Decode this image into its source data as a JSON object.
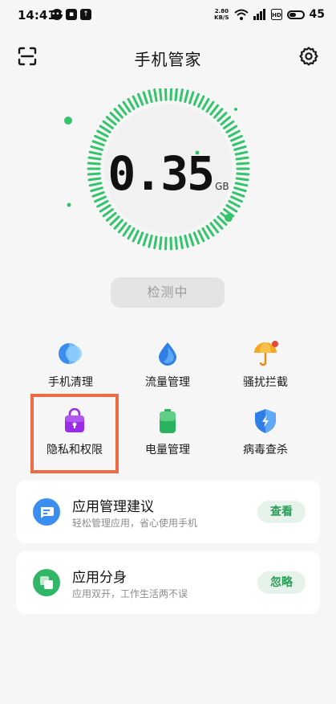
{
  "status_bar": {
    "time": "14:41",
    "net_speed_top": "2.80",
    "net_speed_bottom": "KB/S",
    "battery": "45"
  },
  "header": {
    "title": "手机管家"
  },
  "gauge": {
    "value": "0.35",
    "unit": "GB",
    "accent_color": "#33c46c"
  },
  "scan_button": {
    "label": "检测中"
  },
  "tools": [
    {
      "label": "手机清理",
      "icon": "phone-clean-icon"
    },
    {
      "label": "流量管理",
      "icon": "data-drop-icon"
    },
    {
      "label": "骚扰拦截",
      "icon": "umbrella-icon"
    },
    {
      "label": "隐私和权限",
      "icon": "privacy-bag-icon"
    },
    {
      "label": "电量管理",
      "icon": "battery-icon"
    },
    {
      "label": "病毒查杀",
      "icon": "shield-icon"
    }
  ],
  "cards": [
    {
      "title": "应用管理建议",
      "subtitle": "轻松管理应用，省心使用手机",
      "button": "查看",
      "icon_color": "#3a8ef0"
    },
    {
      "title": "应用分身",
      "subtitle": "应用双开，工作生活两不误",
      "button": "忽略",
      "icon_color": "#2fb667"
    }
  ]
}
